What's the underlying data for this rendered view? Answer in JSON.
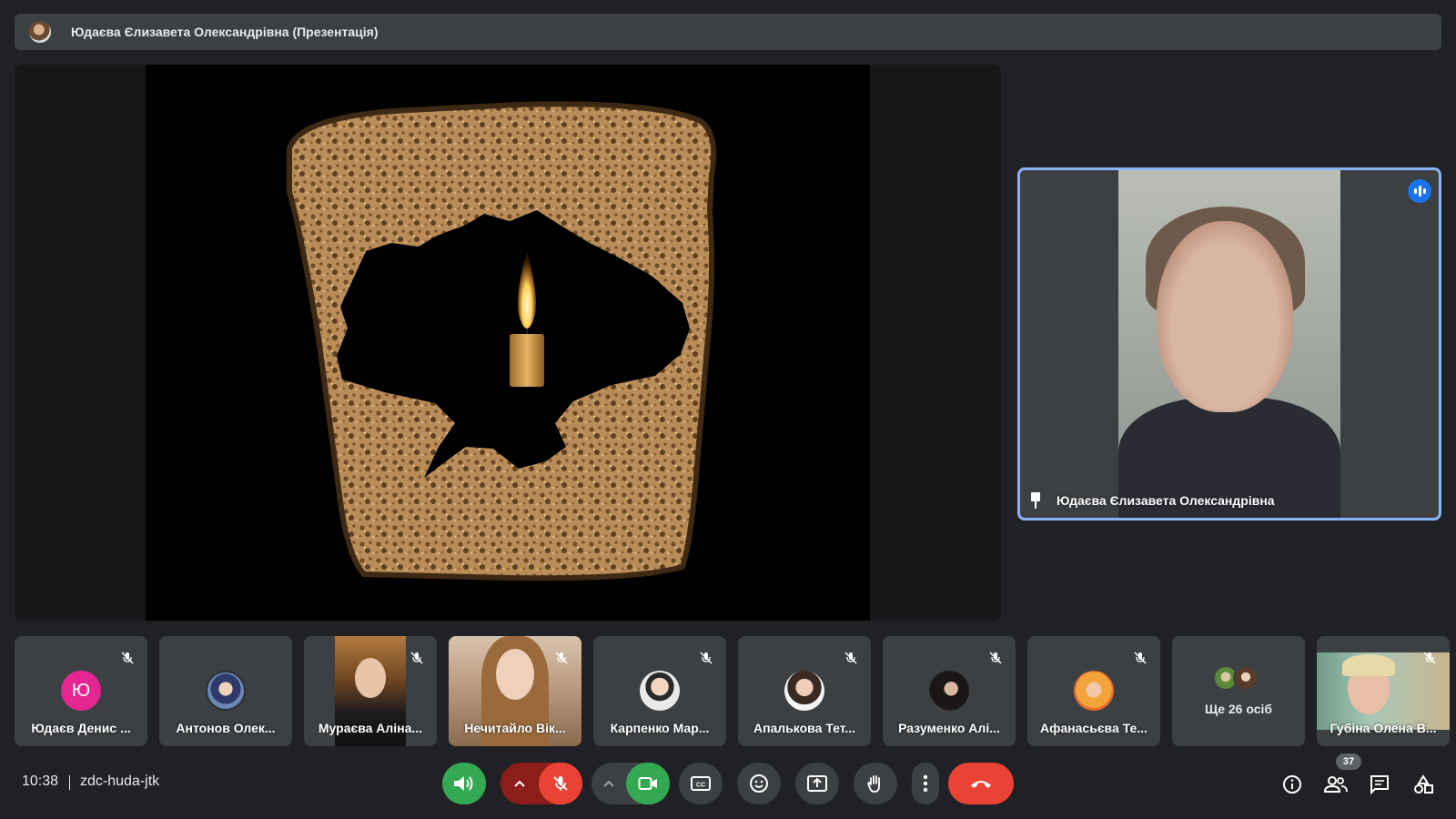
{
  "presentation_bar": {
    "title": "Юдаєва Єлизавета Олександрівна (Презентація)"
  },
  "speaker": {
    "name": "Юдаєва Єлизавета Олександрівна",
    "pin_icon": "pin-icon",
    "speaking_icon": "audio-level-icon"
  },
  "participants": [
    {
      "name": "Юдаєв Денис ...",
      "initial": "Ю",
      "avatar_color": "#e52592",
      "muted": true
    },
    {
      "name": "Антонов Олек...",
      "muted": false
    },
    {
      "name": "Мураєва Аліна...",
      "muted": true
    },
    {
      "name": "Нечитайло Вік...",
      "muted": true
    },
    {
      "name": "Карпенко Мар...",
      "muted": true
    },
    {
      "name": "Апалькова Тет...",
      "muted": true
    },
    {
      "name": "Разуменко Алі...",
      "muted": true
    },
    {
      "name": "Афанасьєва Те...",
      "muted": true
    },
    {
      "name": "Губіна Олена В...",
      "muted": true
    }
  ],
  "more_participants": {
    "label": "Ще 26 осіб"
  },
  "bottom_bar": {
    "time": "10:38",
    "meeting_code": "zdc-huda-jtk",
    "people_count": "37"
  },
  "colors": {
    "background": "#202124",
    "tile": "#3c4043",
    "accent_blue": "#8ab4f8",
    "green": "#34a853",
    "red": "#ea4335",
    "dark_red": "#8c1d18"
  }
}
